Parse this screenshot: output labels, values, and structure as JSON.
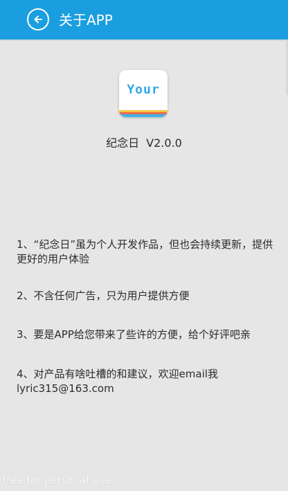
{
  "header": {
    "title": "关于APP",
    "back_icon": "arrow-left-circle-icon",
    "background_color": "#1a9ee0"
  },
  "app": {
    "icon_text": "Your",
    "name": "纪念日",
    "version": "V2.0.0"
  },
  "info_items": [
    "1、“纪念日”虽为个人开发作品，但也会持续更新，提供更好的用户体验",
    "2、不含任何广告，只为用户提供方便",
    "3、要是APP给您带来了些许的方便，给个好评吧亲",
    "4、对产品有啥吐槽的和建议，欢迎email我lyric315@163.com"
  ],
  "watermark": "free for personal use"
}
